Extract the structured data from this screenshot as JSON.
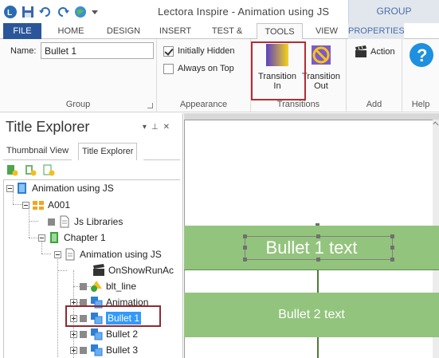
{
  "window": {
    "title": "Lectora Inspire - Animation using JS",
    "context_group": "GROUP"
  },
  "tabs": [
    {
      "label": "FILE"
    },
    {
      "label": "HOME"
    },
    {
      "label": "DESIGN"
    },
    {
      "label": "INSERT"
    },
    {
      "label": "TEST & SURV"
    },
    {
      "label": "TOOLS"
    },
    {
      "label": "VIEW"
    },
    {
      "label": "PROPERTIES"
    }
  ],
  "ribbon": {
    "group_section": {
      "name_label": "Name:",
      "name_value": "Bullet 1",
      "label": "Group"
    },
    "appearance": {
      "initially_hidden": "Initially Hidden",
      "initially_hidden_checked": true,
      "always_on_top": "Always on Top",
      "always_on_top_checked": false,
      "label": "Appearance"
    },
    "transitions": {
      "transition_in": "Transition In",
      "transition_out": "Transition Out",
      "label": "Transitions"
    },
    "add": {
      "action": "Action",
      "label": "Add"
    },
    "help": {
      "label": "Help"
    }
  },
  "explorer": {
    "title": "Title Explorer",
    "subtabs": [
      "Thumbnail View",
      "Title Explorer"
    ],
    "tree": [
      {
        "label": "Animation using JS"
      },
      {
        "label": "A001"
      },
      {
        "label": "Js Libraries"
      },
      {
        "label": "Chapter 1"
      },
      {
        "label": "Animation using JS"
      },
      {
        "label": "OnShowRunAc"
      },
      {
        "label": "blt_line"
      },
      {
        "label": "Animation"
      },
      {
        "label": "Bullet 1"
      },
      {
        "label": "Bullet 2"
      },
      {
        "label": "Bullet 3"
      }
    ]
  },
  "stage": {
    "bullet1_text": "Bullet 1 text",
    "bullet2_text": "Bullet 2 text"
  },
  "colors": {
    "file_tab": "#2b579a",
    "band": "#93c47d",
    "highlight": "#b22d34",
    "selection": "#3399ff"
  }
}
